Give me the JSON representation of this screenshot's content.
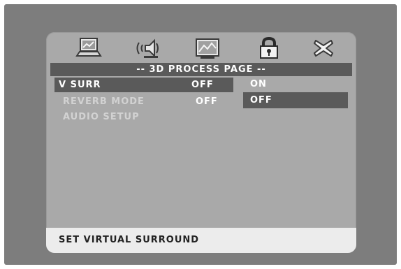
{
  "icons": [
    {
      "name": "general-setup-icon"
    },
    {
      "name": "audio-speaker-icon"
    },
    {
      "name": "video-picture-icon"
    },
    {
      "name": "lock-icon"
    },
    {
      "name": "exit-icon"
    }
  ],
  "header": {
    "title": "-- 3D PROCESS PAGE --"
  },
  "menu": {
    "items": [
      {
        "label": "V SURR",
        "value": "OFF"
      },
      {
        "label": "REVERB MODE",
        "value": "OFF"
      },
      {
        "label": "AUDIO SETUP",
        "value": ""
      }
    ]
  },
  "submenu": {
    "options": [
      {
        "label": "ON"
      },
      {
        "label": "OFF"
      }
    ]
  },
  "status": {
    "text": "SET VIRTUAL SURROUND"
  },
  "colors": {
    "panel": "#a9a9a9",
    "highlight": "#5a5a5a",
    "status_bar": "#ececec"
  }
}
